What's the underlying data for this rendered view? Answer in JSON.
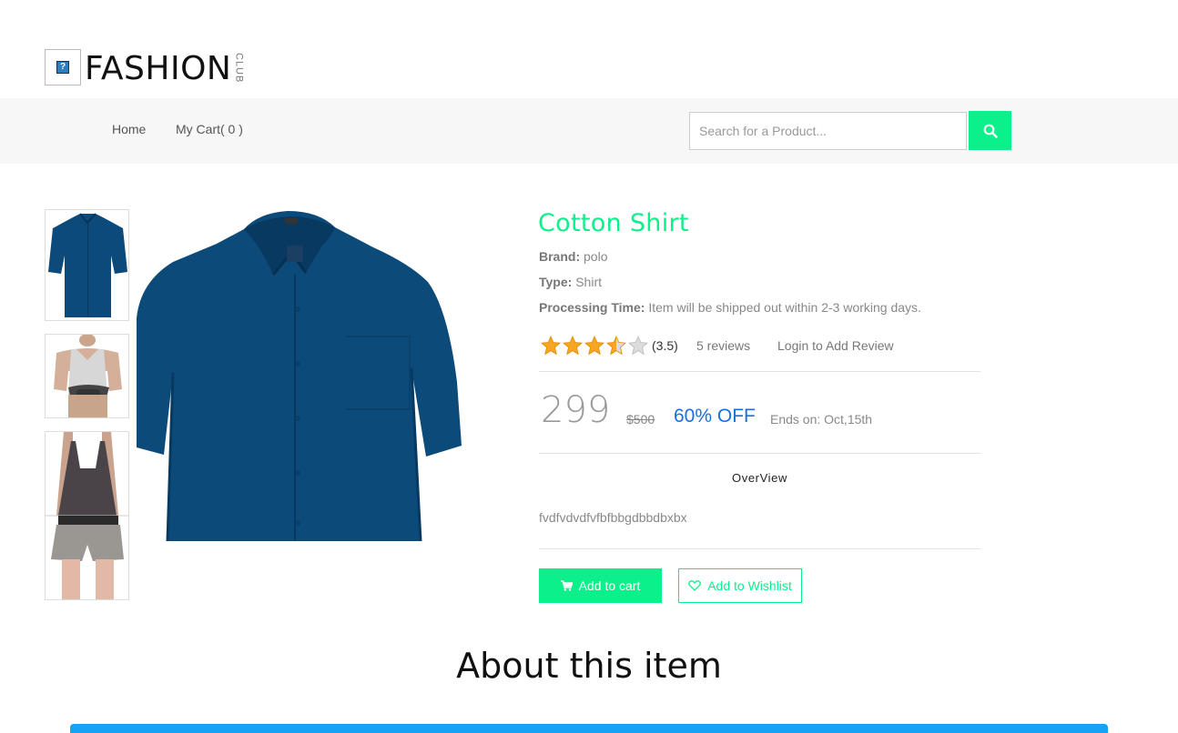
{
  "logo": {
    "text": "FASHION",
    "sub": "CLUB"
  },
  "nav": {
    "home": "Home",
    "cart": "My Cart( 0 )"
  },
  "search": {
    "placeholder": "Search for a Product...",
    "icon": "search-icon"
  },
  "product": {
    "title": "Cotton Shirt",
    "brand_label": "Brand:",
    "brand": "polo",
    "type_label": "Type:",
    "type": "Shirt",
    "processing_label": "Processing Time:",
    "processing": "Item will be shipped out within 2-3 working days.",
    "rating": 3.5,
    "rating_text": "(3.5)",
    "reviews": "5 reviews",
    "login_review": "Login to Add Review",
    "price": "299",
    "old_price": "$500",
    "discount": "60% OFF",
    "ends": "Ends on: Oct,15th",
    "overview_heading": "OverView",
    "overview_text": "fvdfvdvdfvfbfbbgdbbdbxbx",
    "add_to_cart": "Add to cart",
    "add_to_wishlist": "Add to Wishlist"
  },
  "about_heading": "About this item",
  "colors": {
    "accent": "#0cf08b",
    "discount": "#1a6fe0",
    "bar": "#17a3f5"
  }
}
